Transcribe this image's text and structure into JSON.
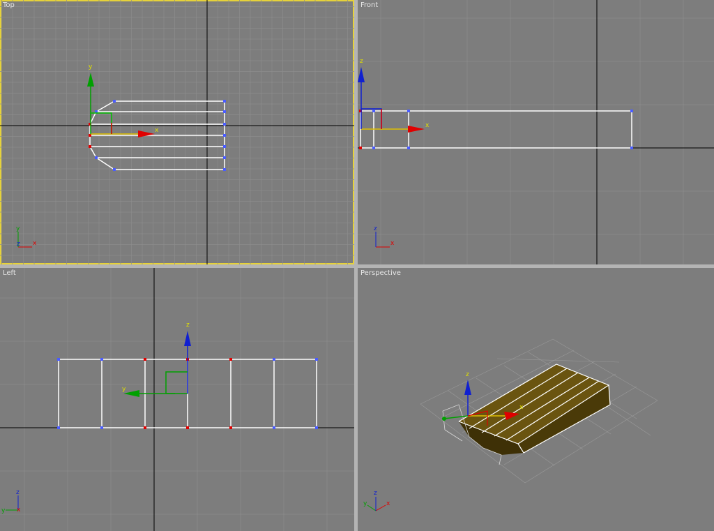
{
  "viewports": {
    "top": {
      "label": "Top",
      "gizmo_x": "x",
      "gizmo_y": "y",
      "tripod_z": "z",
      "tripod_x": "x",
      "tripod_y": "y"
    },
    "front": {
      "label": "Front",
      "gizmo_x": "x",
      "gizmo_z": "z",
      "tripod_z": "z",
      "tripod_x": "x"
    },
    "left": {
      "label": "Left",
      "gizmo_y": "y",
      "gizmo_z": "z",
      "tripod_z": "z",
      "tripod_y": "y",
      "tripod_x": "x"
    },
    "perspective": {
      "label": "Perspective",
      "gizmo_x": "x",
      "gizmo_z": "z",
      "tripod_z": "z",
      "tripod_y": "y",
      "tripod_x": "x"
    }
  },
  "colors": {
    "viewport_bg": "#7d7d7d",
    "active_border": "#e6d23a",
    "grid": "#8c8c8c",
    "axis": "#000000",
    "wire": "#ffffff",
    "vertex": "#4a5cff",
    "vertex_selected": "#e00000",
    "gizmo_x": "#e00000",
    "gizmo_y": "#00a000",
    "gizmo_z": "#1020d0",
    "object_fill": "#6a5410"
  }
}
